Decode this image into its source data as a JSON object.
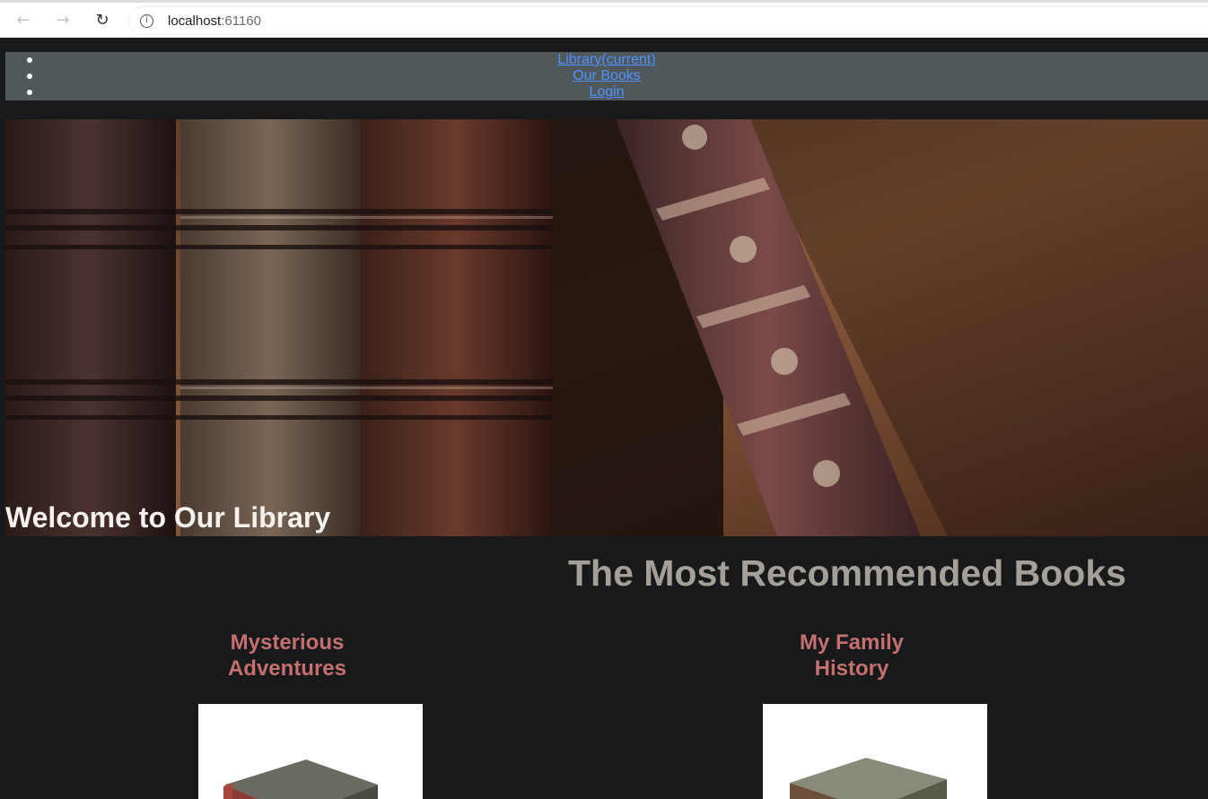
{
  "browser": {
    "url_host": "localhost",
    "url_port": ":61160"
  },
  "nav": {
    "items": [
      {
        "label": "Library(current)"
      },
      {
        "label": "Our Books"
      },
      {
        "label": "Login"
      }
    ]
  },
  "hero": {
    "title": "Welcome to Our Library"
  },
  "main": {
    "section_title": "The Most Recommended Books",
    "books": [
      {
        "title_line1": "Mysterious",
        "title_line2": "Adventures"
      },
      {
        "title_line1": "My Family",
        "title_line2": "History"
      }
    ]
  },
  "colors": {
    "page_bg": "#17191b",
    "navbar_bg": "#50585c",
    "link": "#4c93ff",
    "section_title": "#a49f98",
    "book_title": "#c56f6f"
  }
}
